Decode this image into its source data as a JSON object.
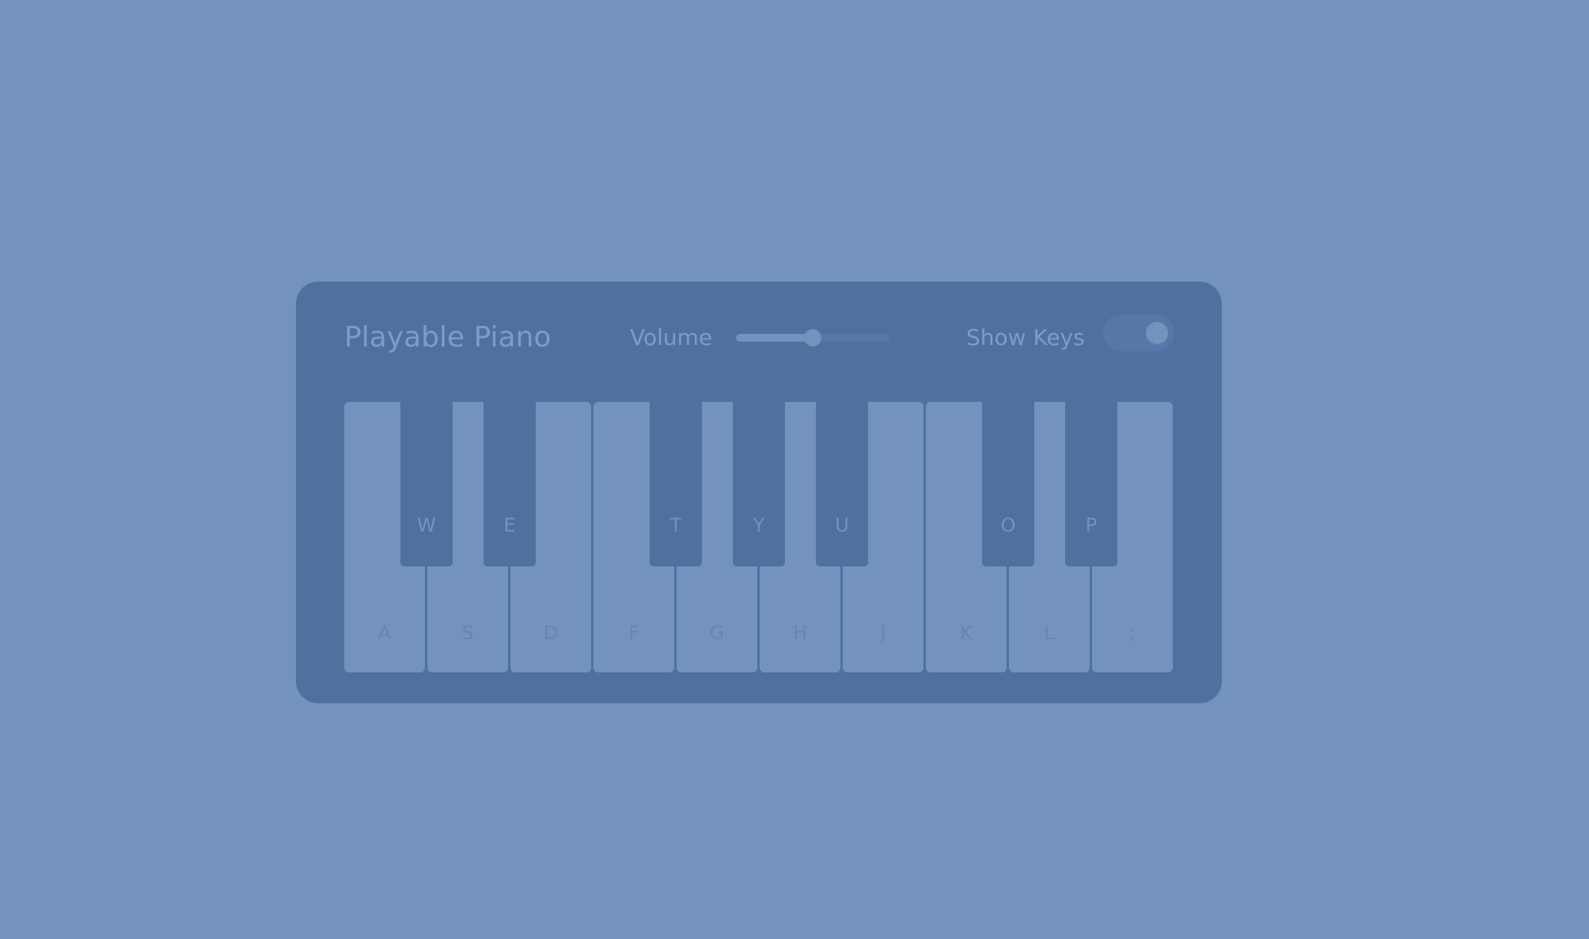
{
  "header": {
    "title": "Playable Piano",
    "volume_label": "Volume",
    "volume_level": 0.5,
    "show_keys_label": "Show Keys",
    "show_keys_on": true
  },
  "keyboard": {
    "white_keys": [
      "A",
      "S",
      "D",
      "F",
      "G",
      "H",
      "J",
      "K",
      "L",
      ";"
    ],
    "black_keys": [
      {
        "label": "W",
        "after_white": 0
      },
      {
        "label": "E",
        "after_white": 1
      },
      {
        "label": "T",
        "after_white": 3
      },
      {
        "label": "Y",
        "after_white": 4
      },
      {
        "label": "U",
        "after_white": 5
      },
      {
        "label": "O",
        "after_white": 7
      },
      {
        "label": "P",
        "after_white": 8
      }
    ]
  },
  "colors": {
    "background": "#7392bd",
    "panel": "#4f71a0",
    "white_key": "#7392bd",
    "black_key": "#4f71a0",
    "text": "#7e9cc7"
  }
}
